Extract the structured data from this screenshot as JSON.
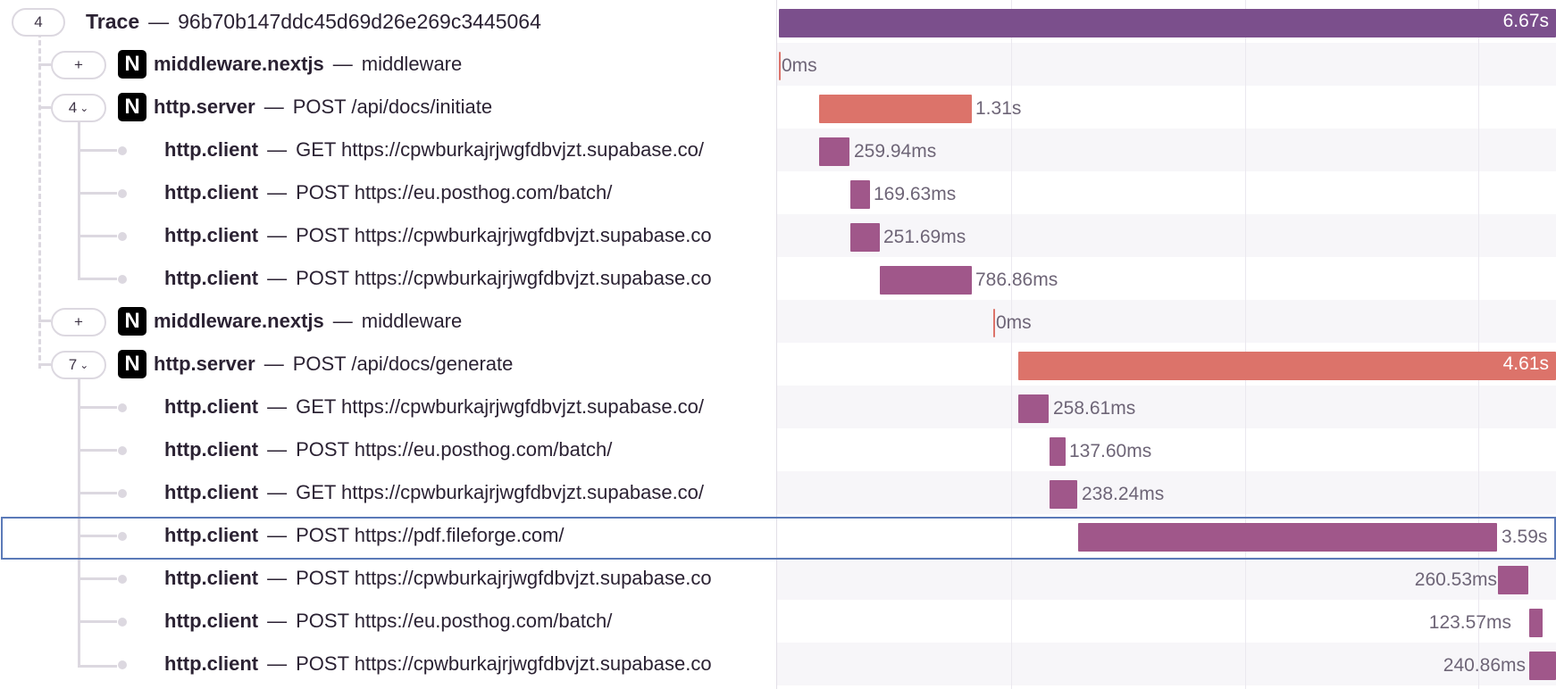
{
  "trace": {
    "count": "4",
    "label": "Trace",
    "separator": "—",
    "id": "96b70b147ddc45d69d26e269c3445064",
    "duration": "6.67s"
  },
  "spans": [
    {
      "op": "middleware.nextjs",
      "sep": "—",
      "desc": "middleware",
      "duration": "0ms",
      "toggle": "+"
    },
    {
      "op": "http.server",
      "sep": "—",
      "desc": "POST /api/docs/initiate",
      "duration": "1.31s",
      "toggle": "4"
    },
    {
      "op": "http.client",
      "sep": "—",
      "desc": "GET https://cpwburkajrjwgfdbvjzt.supabase.co/",
      "duration": "259.94ms"
    },
    {
      "op": "http.client",
      "sep": "—",
      "desc": "POST https://eu.posthog.com/batch/",
      "duration": "169.63ms"
    },
    {
      "op": "http.client",
      "sep": "—",
      "desc": "POST https://cpwburkajrjwgfdbvjzt.supabase.co",
      "duration": "251.69ms"
    },
    {
      "op": "http.client",
      "sep": "—",
      "desc": "POST https://cpwburkajrjwgfdbvjzt.supabase.co",
      "duration": "786.86ms"
    },
    {
      "op": "middleware.nextjs",
      "sep": "—",
      "desc": "middleware",
      "duration": "0ms",
      "toggle": "+"
    },
    {
      "op": "http.server",
      "sep": "—",
      "desc": "POST /api/docs/generate",
      "duration": "4.61s",
      "toggle": "7"
    },
    {
      "op": "http.client",
      "sep": "—",
      "desc": "GET https://cpwburkajrjwgfdbvjzt.supabase.co/",
      "duration": "258.61ms"
    },
    {
      "op": "http.client",
      "sep": "—",
      "desc": "POST https://eu.posthog.com/batch/",
      "duration": "137.60ms"
    },
    {
      "op": "http.client",
      "sep": "—",
      "desc": "GET https://cpwburkajrjwgfdbvjzt.supabase.co/",
      "duration": "238.24ms"
    },
    {
      "op": "http.client",
      "sep": "—",
      "desc": "POST https://pdf.fileforge.com/",
      "duration": "3.59s"
    },
    {
      "op": "http.client",
      "sep": "—",
      "desc": "POST https://cpwburkajrjwgfdbvjzt.supabase.co",
      "duration": "260.53ms"
    },
    {
      "op": "http.client",
      "sep": "—",
      "desc": "POST https://eu.posthog.com/batch/",
      "duration": "123.57ms"
    },
    {
      "op": "http.client",
      "sep": "—",
      "desc": "POST https://cpwburkajrjwgfdbvjzt.supabase.co",
      "duration": "240.86ms"
    }
  ],
  "icons": {
    "nextjs": "nextjs-icon",
    "chevron": "chevron-down-icon"
  },
  "colors": {
    "trace_bar": "#7b4f8c",
    "server_bar": "#dc736a",
    "client_bar": "#a0578a",
    "selection": "#5b7ab8"
  }
}
